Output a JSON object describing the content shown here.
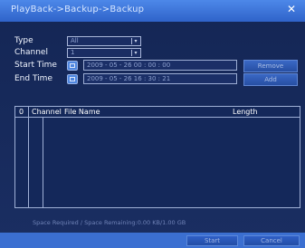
{
  "window": {
    "title": "PlayBack->Backup->Backup",
    "close_glyph": "✕"
  },
  "form": {
    "type_label": "Type",
    "type_value": "All",
    "channel_label": "Channel",
    "channel_value": "1",
    "start_label": "Start Time",
    "start_value": "2009 - 05 - 26  00 : 00 : 00",
    "end_label": "End Time",
    "end_value": "2009 - 05 - 26  16 : 30 : 21"
  },
  "buttons": {
    "remove": "Remove",
    "add": "Add",
    "start": "Start",
    "cancel": "Cancel"
  },
  "table": {
    "columns": [
      "0",
      "Channel",
      "File Name",
      "Length"
    ],
    "rows": []
  },
  "footer": {
    "space_text": "Space Required / Space Remaining:0.00 KB/1.00 GB"
  },
  "icons": {
    "calendar": "calendar-icon",
    "dropdown": "chevron-down-icon",
    "close": "close-icon"
  },
  "colors": {
    "titlebar": "#3f78dd",
    "background": "#1a2e62",
    "bottombar": "#3b6fd1"
  }
}
